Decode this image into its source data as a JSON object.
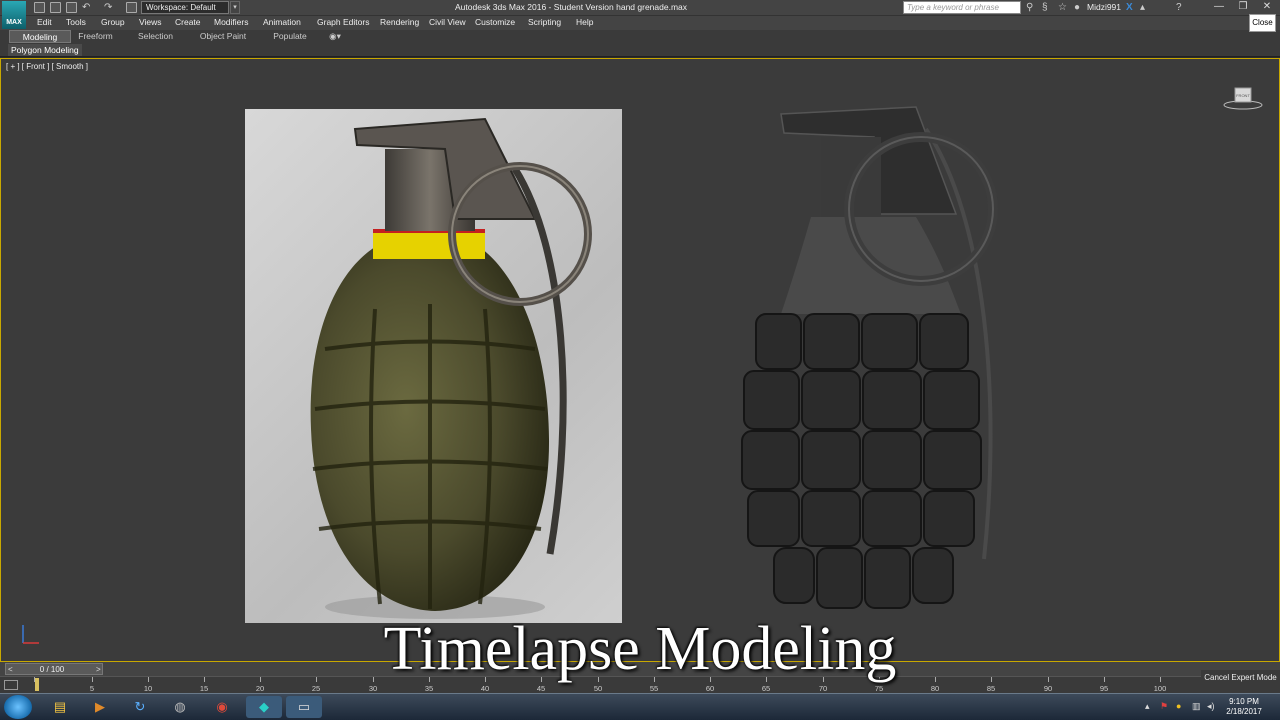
{
  "app": {
    "logo_label": "MAX",
    "window_title": "Autodesk 3ds Max 2016 - Student Version    hand grenade.max",
    "workspace": "Workspace: Default",
    "search_placeholder": "Type a keyword or phrase",
    "username": "Midzi991",
    "close_tooltip": "Close"
  },
  "menu": [
    "Edit",
    "Tools",
    "Group",
    "Views",
    "Create",
    "Modifiers",
    "Animation",
    "Graph Editors",
    "Rendering",
    "Civil View",
    "Customize",
    "Scripting",
    "Help"
  ],
  "ribbon": {
    "tabs": [
      "Modeling",
      "Freeform",
      "Selection",
      "Object Paint",
      "Populate"
    ],
    "active_tab": "Modeling",
    "panel_label": "Polygon Modeling"
  },
  "viewport": {
    "label": "[ + ] [ Front ] [ Smooth ]",
    "viewcube_label": "FRONT"
  },
  "timeline": {
    "frame_counter": "0 / 100",
    "prev": "<",
    "next": ">",
    "ticks": [
      "5",
      "10",
      "15",
      "20",
      "25",
      "30",
      "35",
      "40",
      "45",
      "50",
      "55",
      "60",
      "65",
      "70",
      "75",
      "80",
      "85",
      "90",
      "95",
      "100"
    ],
    "cancel_expert_mode": "Cancel Expert Mode"
  },
  "caption": "Timelapse Modeling",
  "taskbar": {
    "time": "9:10 PM",
    "date": "2/18/2017"
  },
  "colors": {
    "viewport_border": "#c8a800",
    "viewport_bg": "#3b3b3b",
    "grenade_olive": "#4b4a2c",
    "grenade_band_yellow": "#e6d200",
    "model_gray": "#2a2a2a"
  }
}
